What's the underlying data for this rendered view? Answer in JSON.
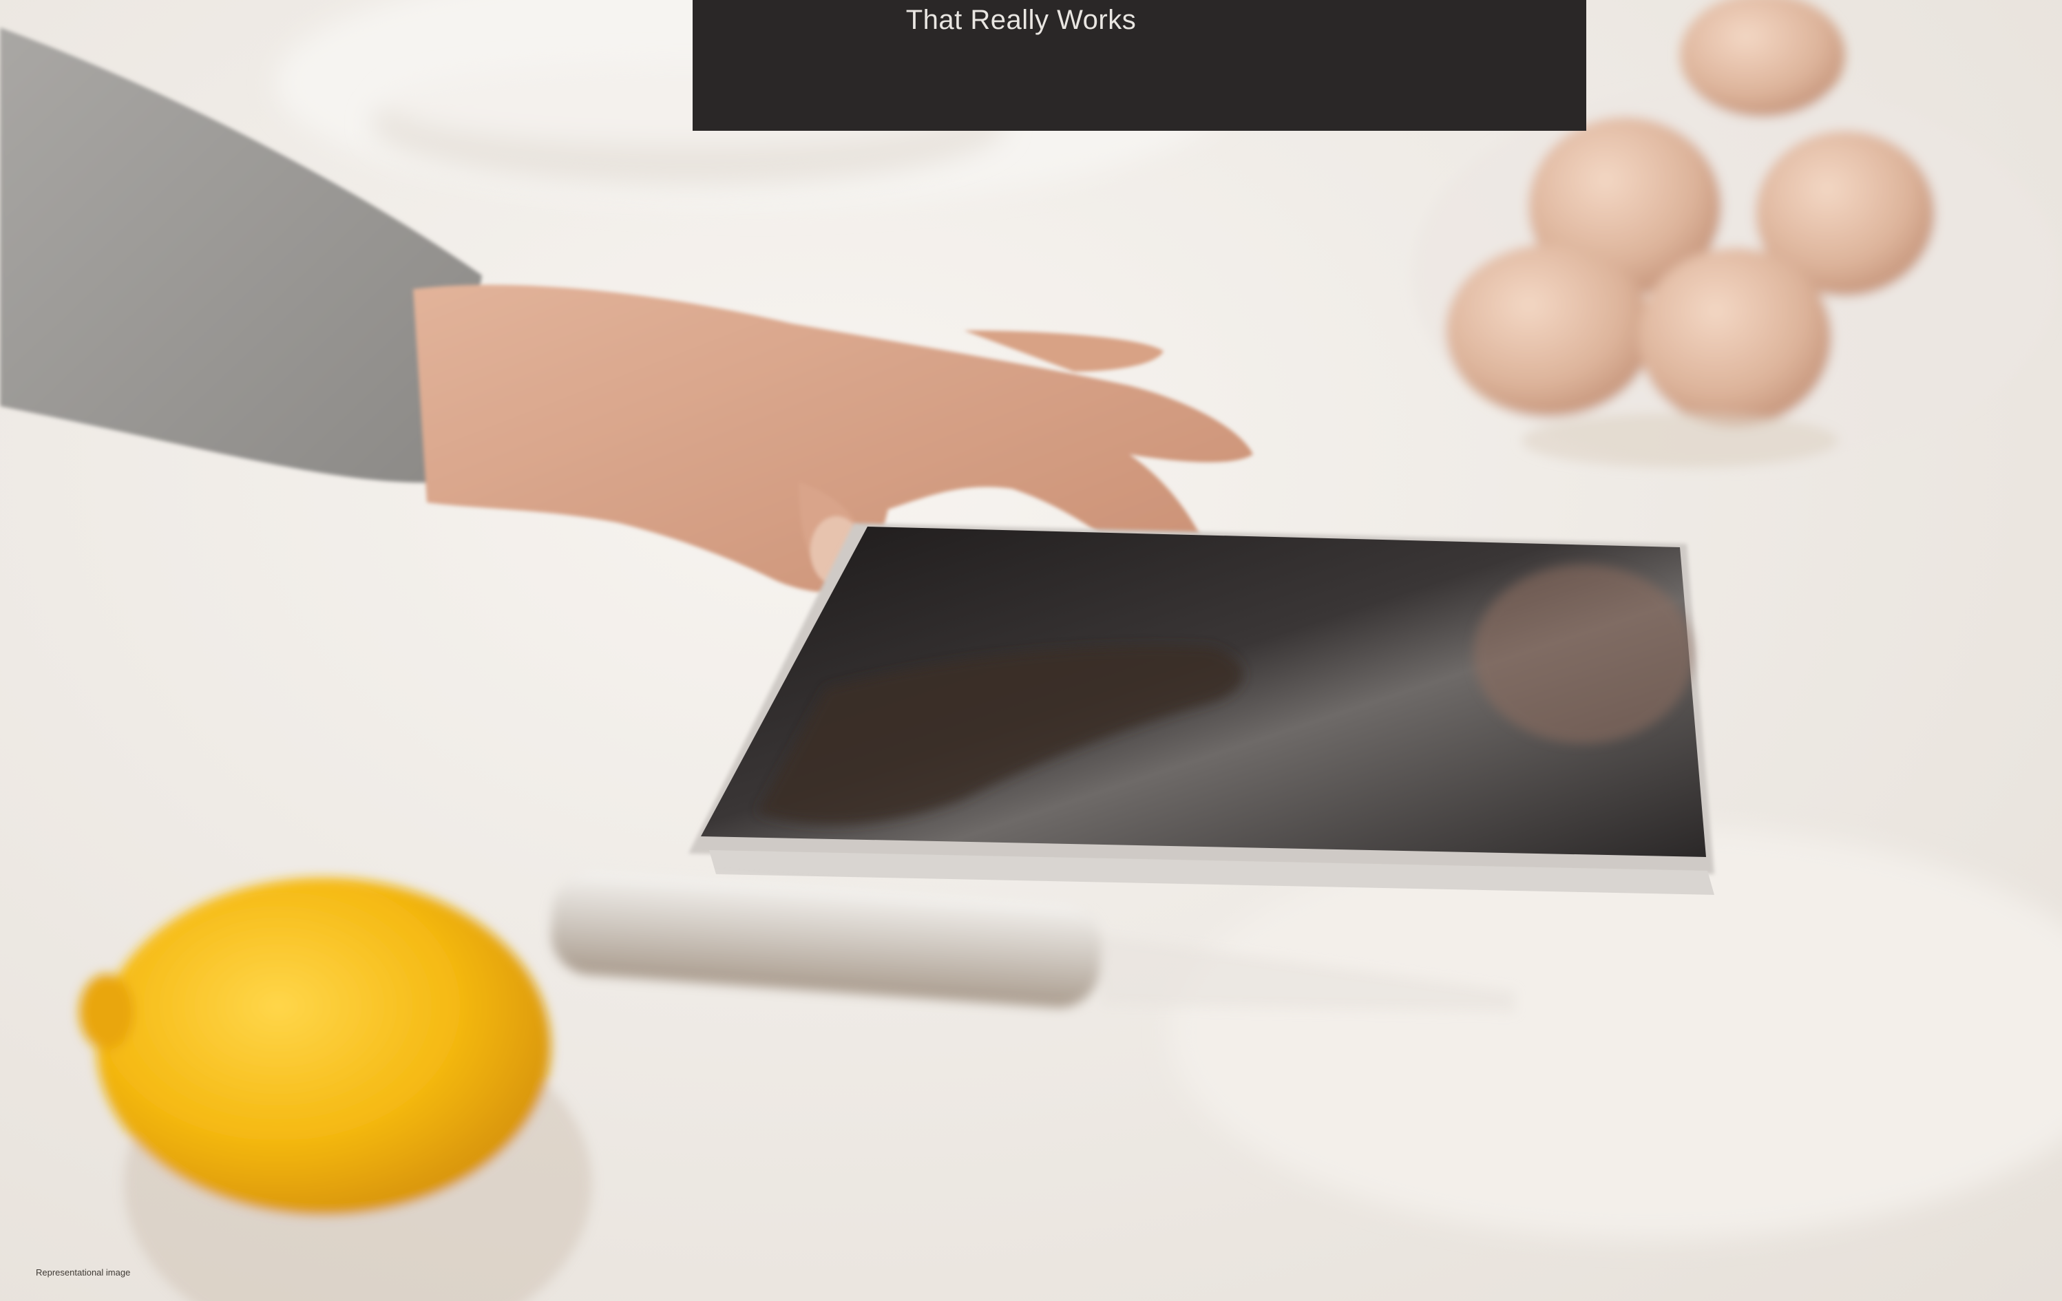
{
  "banner": {
    "text": "That Really Works",
    "background_color": "#2a2727",
    "text_color": "#e9e6e2"
  },
  "caption": {
    "text": "Representational image"
  },
  "photo": {
    "subjects": [
      "hand",
      "tablet",
      "lemon",
      "whisk",
      "bowl-of-eggs",
      "grey-sleeve"
    ]
  }
}
